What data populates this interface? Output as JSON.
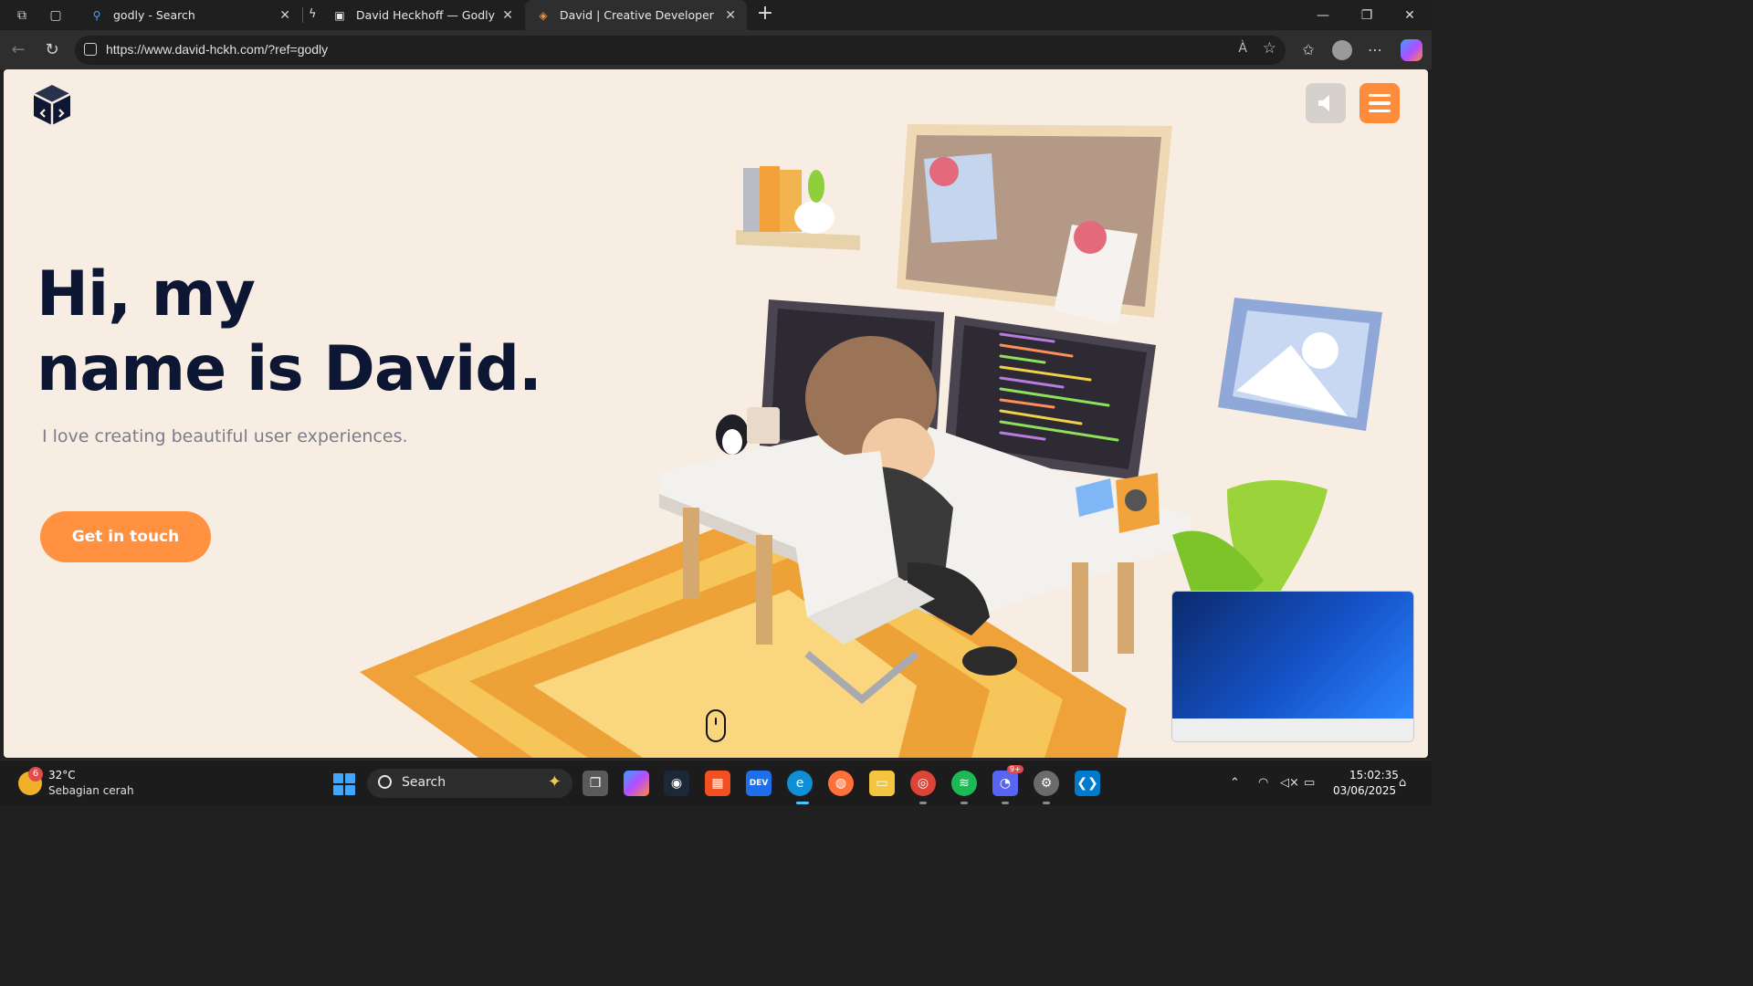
{
  "browser": {
    "tabs": [
      {
        "label": "godly - Search",
        "active": false
      },
      {
        "label": "David Heckhoff — Godly",
        "active": false
      },
      {
        "label": "David | Creative Developer",
        "active": true
      }
    ],
    "url": "https://www.david-hckh.com/?ref=godly",
    "read_aloud": "À"
  },
  "page": {
    "hero_line1": "Hi, my",
    "hero_line2": "name is David.",
    "subtitle": "I love creating beautiful user experiences.",
    "cta_label": "Get in touch",
    "accent_color": "#ff8c3a",
    "heading_color": "#0d1633"
  },
  "taskbar": {
    "weather_temp": "32°C",
    "weather_desc": "Sebagian cerah",
    "weather_badge": "6",
    "search_label": "Search",
    "discord_badge": "9+",
    "time": "15:02:35",
    "date": "03/06/2025"
  }
}
